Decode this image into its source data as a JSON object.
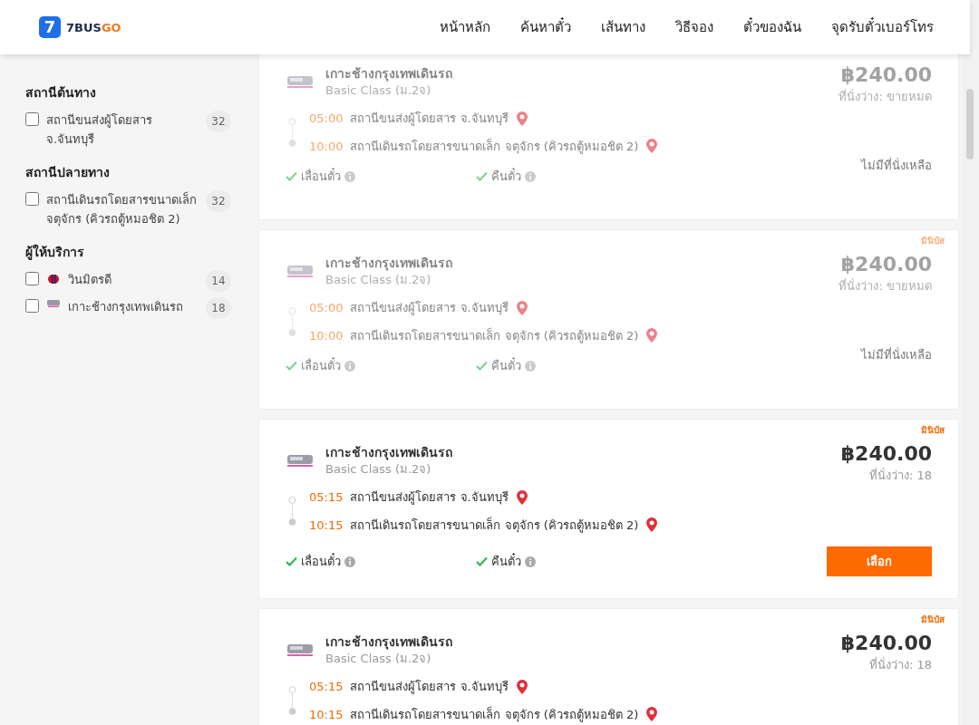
{
  "header": {
    "logo": {
      "mark": "7",
      "name": "7BUS",
      "name_accent": "GO"
    },
    "nav": [
      "หน้าหลัก",
      "ค้นหาตั๋ว",
      "เส้นทาง",
      "วิธีจอง",
      "ตั๋วของฉัน",
      "จุดรับตั๋วเบอร์โทร"
    ]
  },
  "sidebar": {
    "sections": [
      {
        "title": "สถานีต้นทาง",
        "options": [
          {
            "kind": "plain",
            "label": "สถานีขนส่งผู้โดยสาร จ.จันทบุรี",
            "count": "32",
            "checked": false
          }
        ]
      },
      {
        "title": "สถานีปลายทาง",
        "options": [
          {
            "kind": "plain",
            "label": "สถานีเดินรถโดยสารขนาดเล็ก จตุจักร (คิวรถตู้หมอชิต 2)",
            "count": "32",
            "checked": false
          }
        ]
      },
      {
        "title": "ผู้ให้บริการ",
        "options": [
          {
            "kind": "operator_red",
            "label": "วินมิตรดี",
            "count": "14",
            "checked": false
          },
          {
            "kind": "operator_bus",
            "label": "เกาะช้างกรุงเทพเดินรถ",
            "count": "18",
            "checked": false
          }
        ]
      }
    ]
  },
  "results": [
    {
      "operator": "เกาะช้างกรุงเทพเดินรถ",
      "class": "Basic Class (ม.2จ)",
      "price": "฿240.00",
      "seats": "ที่นั่งว่าง: ขายหมด",
      "sold_out": true,
      "departure": {
        "time": "05:00",
        "station": "สถานีขนส่งผู้โดยสาร จ.จันทบุรี"
      },
      "arrival": {
        "time": "10:00",
        "station": "สถานีเดินรถโดยสารขนาดเล็ก จตุจักร (คิวรถตู้หมอชิต 2)"
      },
      "features": [
        "เลื่อนตั๋ว",
        "คืนตั๋ว"
      ],
      "status": "ไม่มีที่นั่งเหลือ"
    },
    {
      "tag": "มินิบัส",
      "operator": "เกาะช้างกรุงเทพเดินรถ",
      "class": "Basic Class (ม.2จ)",
      "price": "฿240.00",
      "seats": "ที่นั่งว่าง: ขายหมด",
      "sold_out": true,
      "departure": {
        "time": "05:00",
        "station": "สถานีขนส่งผู้โดยสาร จ.จันทบุรี"
      },
      "arrival": {
        "time": "10:00",
        "station": "สถานีเดินรถโดยสารขนาดเล็ก จตุจักร (คิวรถตู้หมอชิต 2)"
      },
      "features": [
        "เลื่อนตั๋ว",
        "คืนตั๋ว"
      ],
      "status": "ไม่มีที่นั่งเหลือ"
    },
    {
      "tag": "มินิบัส",
      "operator": "เกาะช้างกรุงเทพเดินรถ",
      "class": "Basic Class (ม.2จ)",
      "price": "฿240.00",
      "seats": "ที่นั่งว่าง: 18",
      "sold_out": false,
      "departure": {
        "time": "05:15",
        "station": "สถานีขนส่งผู้โดยสาร จ.จันทบุรี"
      },
      "arrival": {
        "time": "10:15",
        "station": "สถานีเดินรถโดยสารขนาดเล็ก จตุจักร (คิวรถตู้หมอชิต 2)"
      },
      "features": [
        "เลื่อนตั๋ว",
        "คืนตั๋ว"
      ],
      "button": "เลือก"
    },
    {
      "tag": "มินิบัส",
      "operator": "เกาะช้างกรุงเทพเดินรถ",
      "class": "Basic Class (ม.2จ)",
      "price": "฿240.00",
      "seats": "ที่นั่งว่าง: 18",
      "sold_out": false,
      "departure": {
        "time": "05:15",
        "station": "สถานีขนส่งผู้โดยสาร จ.จันทบุรี"
      },
      "arrival": {
        "time": "10:15",
        "station": "สถานีเดินรถโดยสารขนาดเล็ก จตุจักร (คิวรถตู้หมอชิต 2)"
      }
    }
  ]
}
